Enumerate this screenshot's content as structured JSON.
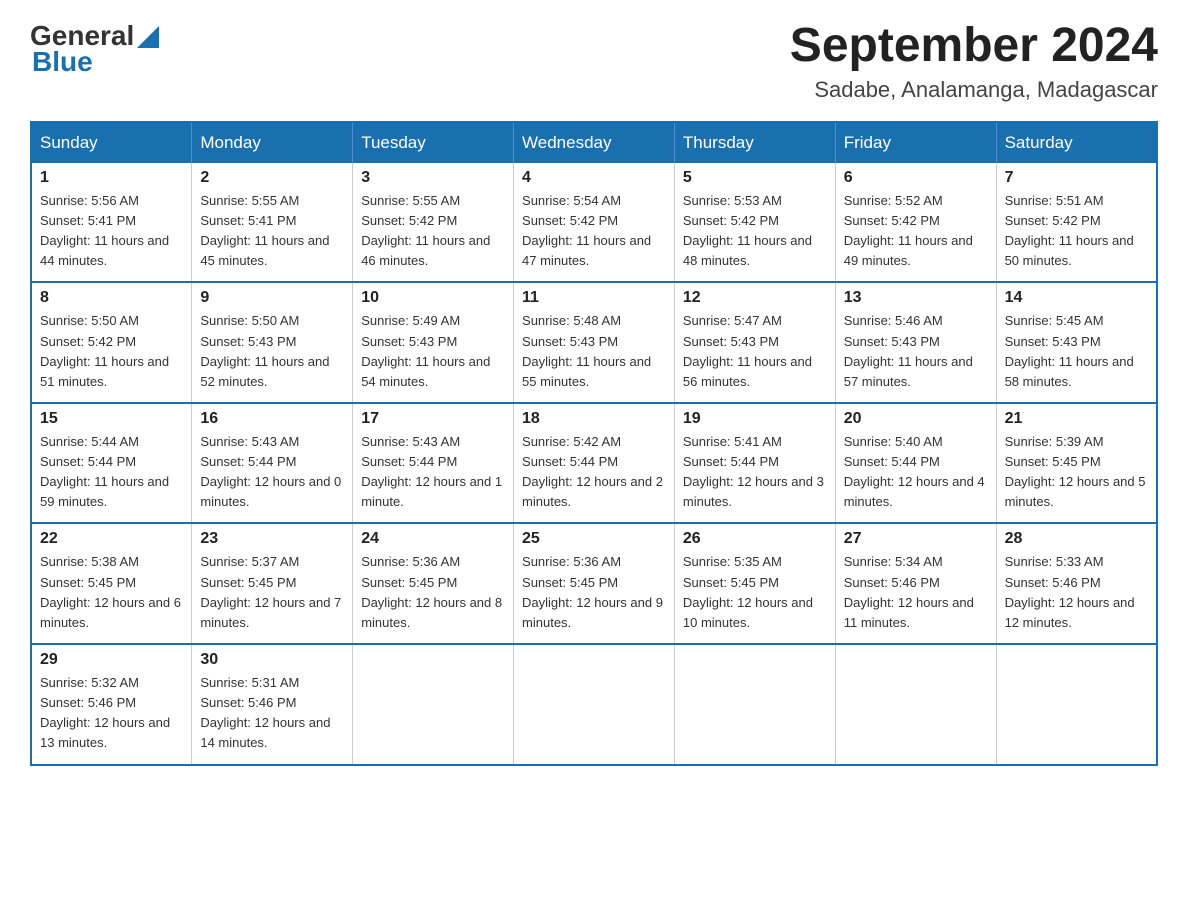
{
  "header": {
    "logo": {
      "general": "General",
      "blue": "Blue"
    },
    "title": "September 2024",
    "subtitle": "Sadabe, Analamanga, Madagascar"
  },
  "weekdays": [
    "Sunday",
    "Monday",
    "Tuesday",
    "Wednesday",
    "Thursday",
    "Friday",
    "Saturday"
  ],
  "weeks": [
    [
      {
        "day": "1",
        "sunrise": "5:56 AM",
        "sunset": "5:41 PM",
        "daylight": "11 hours and 44 minutes."
      },
      {
        "day": "2",
        "sunrise": "5:55 AM",
        "sunset": "5:41 PM",
        "daylight": "11 hours and 45 minutes."
      },
      {
        "day": "3",
        "sunrise": "5:55 AM",
        "sunset": "5:42 PM",
        "daylight": "11 hours and 46 minutes."
      },
      {
        "day": "4",
        "sunrise": "5:54 AM",
        "sunset": "5:42 PM",
        "daylight": "11 hours and 47 minutes."
      },
      {
        "day": "5",
        "sunrise": "5:53 AM",
        "sunset": "5:42 PM",
        "daylight": "11 hours and 48 minutes."
      },
      {
        "day": "6",
        "sunrise": "5:52 AM",
        "sunset": "5:42 PM",
        "daylight": "11 hours and 49 minutes."
      },
      {
        "day": "7",
        "sunrise": "5:51 AM",
        "sunset": "5:42 PM",
        "daylight": "11 hours and 50 minutes."
      }
    ],
    [
      {
        "day": "8",
        "sunrise": "5:50 AM",
        "sunset": "5:42 PM",
        "daylight": "11 hours and 51 minutes."
      },
      {
        "day": "9",
        "sunrise": "5:50 AM",
        "sunset": "5:43 PM",
        "daylight": "11 hours and 52 minutes."
      },
      {
        "day": "10",
        "sunrise": "5:49 AM",
        "sunset": "5:43 PM",
        "daylight": "11 hours and 54 minutes."
      },
      {
        "day": "11",
        "sunrise": "5:48 AM",
        "sunset": "5:43 PM",
        "daylight": "11 hours and 55 minutes."
      },
      {
        "day": "12",
        "sunrise": "5:47 AM",
        "sunset": "5:43 PM",
        "daylight": "11 hours and 56 minutes."
      },
      {
        "day": "13",
        "sunrise": "5:46 AM",
        "sunset": "5:43 PM",
        "daylight": "11 hours and 57 minutes."
      },
      {
        "day": "14",
        "sunrise": "5:45 AM",
        "sunset": "5:43 PM",
        "daylight": "11 hours and 58 minutes."
      }
    ],
    [
      {
        "day": "15",
        "sunrise": "5:44 AM",
        "sunset": "5:44 PM",
        "daylight": "11 hours and 59 minutes."
      },
      {
        "day": "16",
        "sunrise": "5:43 AM",
        "sunset": "5:44 PM",
        "daylight": "12 hours and 0 minutes."
      },
      {
        "day": "17",
        "sunrise": "5:43 AM",
        "sunset": "5:44 PM",
        "daylight": "12 hours and 1 minute."
      },
      {
        "day": "18",
        "sunrise": "5:42 AM",
        "sunset": "5:44 PM",
        "daylight": "12 hours and 2 minutes."
      },
      {
        "day": "19",
        "sunrise": "5:41 AM",
        "sunset": "5:44 PM",
        "daylight": "12 hours and 3 minutes."
      },
      {
        "day": "20",
        "sunrise": "5:40 AM",
        "sunset": "5:44 PM",
        "daylight": "12 hours and 4 minutes."
      },
      {
        "day": "21",
        "sunrise": "5:39 AM",
        "sunset": "5:45 PM",
        "daylight": "12 hours and 5 minutes."
      }
    ],
    [
      {
        "day": "22",
        "sunrise": "5:38 AM",
        "sunset": "5:45 PM",
        "daylight": "12 hours and 6 minutes."
      },
      {
        "day": "23",
        "sunrise": "5:37 AM",
        "sunset": "5:45 PM",
        "daylight": "12 hours and 7 minutes."
      },
      {
        "day": "24",
        "sunrise": "5:36 AM",
        "sunset": "5:45 PM",
        "daylight": "12 hours and 8 minutes."
      },
      {
        "day": "25",
        "sunrise": "5:36 AM",
        "sunset": "5:45 PM",
        "daylight": "12 hours and 9 minutes."
      },
      {
        "day": "26",
        "sunrise": "5:35 AM",
        "sunset": "5:45 PM",
        "daylight": "12 hours and 10 minutes."
      },
      {
        "day": "27",
        "sunrise": "5:34 AM",
        "sunset": "5:46 PM",
        "daylight": "12 hours and 11 minutes."
      },
      {
        "day": "28",
        "sunrise": "5:33 AM",
        "sunset": "5:46 PM",
        "daylight": "12 hours and 12 minutes."
      }
    ],
    [
      {
        "day": "29",
        "sunrise": "5:32 AM",
        "sunset": "5:46 PM",
        "daylight": "12 hours and 13 minutes."
      },
      {
        "day": "30",
        "sunrise": "5:31 AM",
        "sunset": "5:46 PM",
        "daylight": "12 hours and 14 minutes."
      },
      null,
      null,
      null,
      null,
      null
    ]
  ],
  "labels": {
    "sunrise": "Sunrise:",
    "sunset": "Sunset:",
    "daylight": "Daylight:"
  }
}
